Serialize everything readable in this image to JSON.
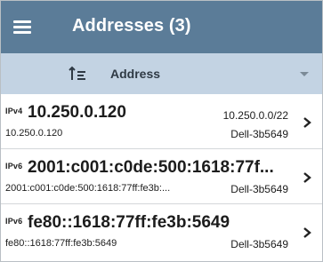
{
  "header": {
    "title": "Addresses (3)",
    "menu_icon": "hamburger-menu-icon"
  },
  "sort": {
    "icon": "sort-ascending-icon",
    "label": "Address",
    "caret_icon": "caret-down-icon"
  },
  "colors": {
    "appbar": "#5b7c98",
    "sortbar": "#c3d3e3",
    "text": "#1c1c1c"
  },
  "addresses": [
    {
      "version": "IPv4",
      "address": "10.250.0.120",
      "subnet": "10.250.0.0/22",
      "detail": "10.250.0.120",
      "host": "Dell-3b5649"
    },
    {
      "version": "IPv6",
      "address": "2001:c001:c0de:500:1618:77f...",
      "subnet": "",
      "detail": "2001:c001:c0de:500:1618:77ff:fe3b:...",
      "host": "Dell-3b5649"
    },
    {
      "version": "IPv6",
      "address": "fe80::1618:77ff:fe3b:5649",
      "subnet": "",
      "detail": "fe80::1618:77ff:fe3b:5649",
      "host": "Dell-3b5649"
    }
  ]
}
